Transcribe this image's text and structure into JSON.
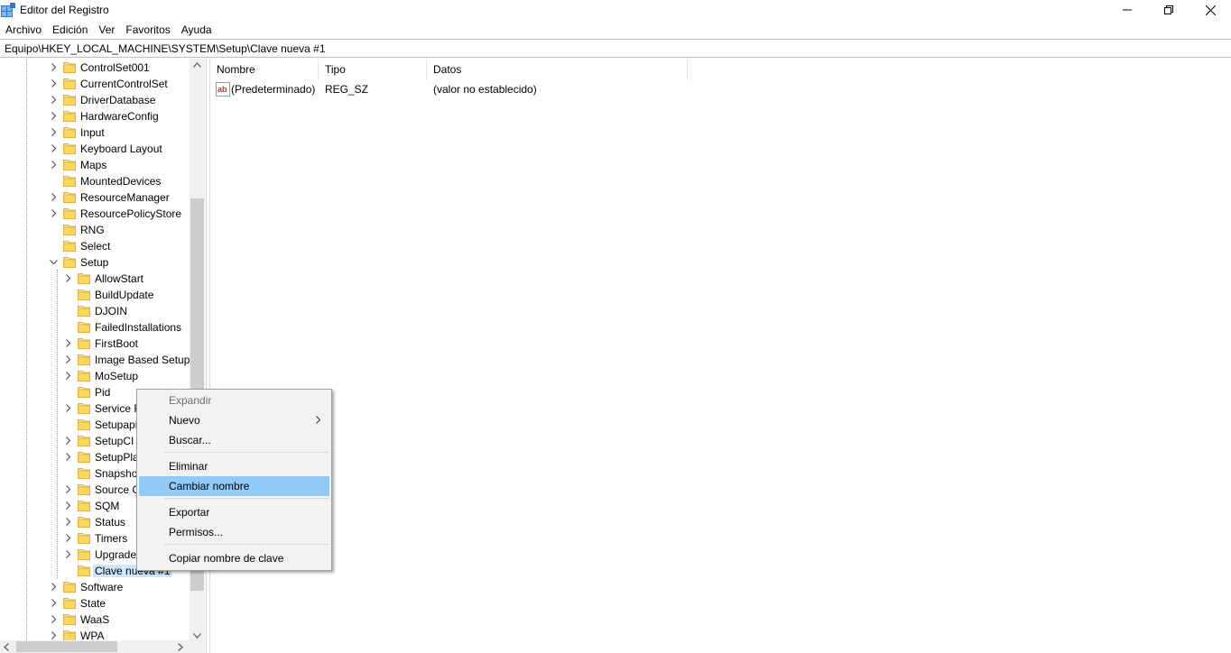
{
  "window": {
    "title": "Editor del Registro",
    "controls": {
      "minimize": "minimize-icon",
      "maximize": "restore-icon",
      "close": "close-icon"
    }
  },
  "menu": [
    "Archivo",
    "Edición",
    "Ver",
    "Favoritos",
    "Ayuda"
  ],
  "address": "Equipo\\HKEY_LOCAL_MACHINE\\SYSTEM\\Setup\\Clave nueva #1",
  "tree": {
    "items": [
      {
        "label": "ControlSet001",
        "expand": "collapsed",
        "indent": 0
      },
      {
        "label": "CurrentControlSet",
        "expand": "collapsed",
        "indent": 0
      },
      {
        "label": "DriverDatabase",
        "expand": "collapsed",
        "indent": 0
      },
      {
        "label": "HardwareConfig",
        "expand": "collapsed",
        "indent": 0
      },
      {
        "label": "Input",
        "expand": "collapsed",
        "indent": 0
      },
      {
        "label": "Keyboard Layout",
        "expand": "collapsed",
        "indent": 0
      },
      {
        "label": "Maps",
        "expand": "collapsed",
        "indent": 0
      },
      {
        "label": "MountedDevices",
        "expand": "none",
        "indent": 0
      },
      {
        "label": "ResourceManager",
        "expand": "collapsed",
        "indent": 0
      },
      {
        "label": "ResourcePolicyStore",
        "expand": "collapsed",
        "indent": 0
      },
      {
        "label": "RNG",
        "expand": "none",
        "indent": 0
      },
      {
        "label": "Select",
        "expand": "none",
        "indent": 0
      },
      {
        "label": "Setup",
        "expand": "expanded",
        "indent": 0
      },
      {
        "label": "AllowStart",
        "expand": "collapsed",
        "indent": 1
      },
      {
        "label": "BuildUpdate",
        "expand": "none",
        "indent": 1
      },
      {
        "label": "DJOIN",
        "expand": "none",
        "indent": 1
      },
      {
        "label": "FailedInstallations",
        "expand": "none",
        "indent": 1
      },
      {
        "label": "FirstBoot",
        "expand": "collapsed",
        "indent": 1
      },
      {
        "label": "Image Based Setup",
        "expand": "collapsed",
        "indent": 1
      },
      {
        "label": "MoSetup",
        "expand": "collapsed",
        "indent": 1
      },
      {
        "label": "Pid",
        "expand": "none",
        "indent": 1
      },
      {
        "label": "Service R",
        "expand": "collapsed",
        "indent": 1
      },
      {
        "label": "Setupapi",
        "expand": "none",
        "indent": 1
      },
      {
        "label": "SetupCI",
        "expand": "collapsed",
        "indent": 1
      },
      {
        "label": "SetupPla",
        "expand": "collapsed",
        "indent": 1
      },
      {
        "label": "Snapshot",
        "expand": "none",
        "indent": 1
      },
      {
        "label": "Source C",
        "expand": "collapsed",
        "indent": 1
      },
      {
        "label": "SQM",
        "expand": "collapsed",
        "indent": 1
      },
      {
        "label": "Status",
        "expand": "collapsed",
        "indent": 1
      },
      {
        "label": "Timers",
        "expand": "collapsed",
        "indent": 1
      },
      {
        "label": "Upgrade",
        "expand": "collapsed",
        "indent": 1
      },
      {
        "label": "Clave nueva #1",
        "expand": "none",
        "indent": 1,
        "selected": true
      },
      {
        "label": "Software",
        "expand": "collapsed",
        "indent": 0
      },
      {
        "label": "State",
        "expand": "collapsed",
        "indent": 0
      },
      {
        "label": "WaaS",
        "expand": "collapsed",
        "indent": 0
      },
      {
        "label": "WPA",
        "expand": "collapsed",
        "indent": 0
      }
    ]
  },
  "values": {
    "columns": [
      "Nombre",
      "Tipo",
      "Datos"
    ],
    "rows": [
      {
        "icon": "string-value-icon",
        "name": "(Predeterminado)",
        "type": "REG_SZ",
        "data": "(valor no establecido)"
      }
    ]
  },
  "context_menu": {
    "items": [
      {
        "label": "Expandir",
        "disabled": true
      },
      {
        "label": "Nuevo",
        "submenu": true
      },
      {
        "label": "Buscar..."
      },
      {
        "separator": true
      },
      {
        "label": "Eliminar"
      },
      {
        "label": "Cambiar nombre",
        "highlighted": true
      },
      {
        "separator": true
      },
      {
        "label": "Exportar"
      },
      {
        "label": "Permisos..."
      },
      {
        "separator": true
      },
      {
        "label": "Copiar nombre de clave"
      }
    ]
  }
}
